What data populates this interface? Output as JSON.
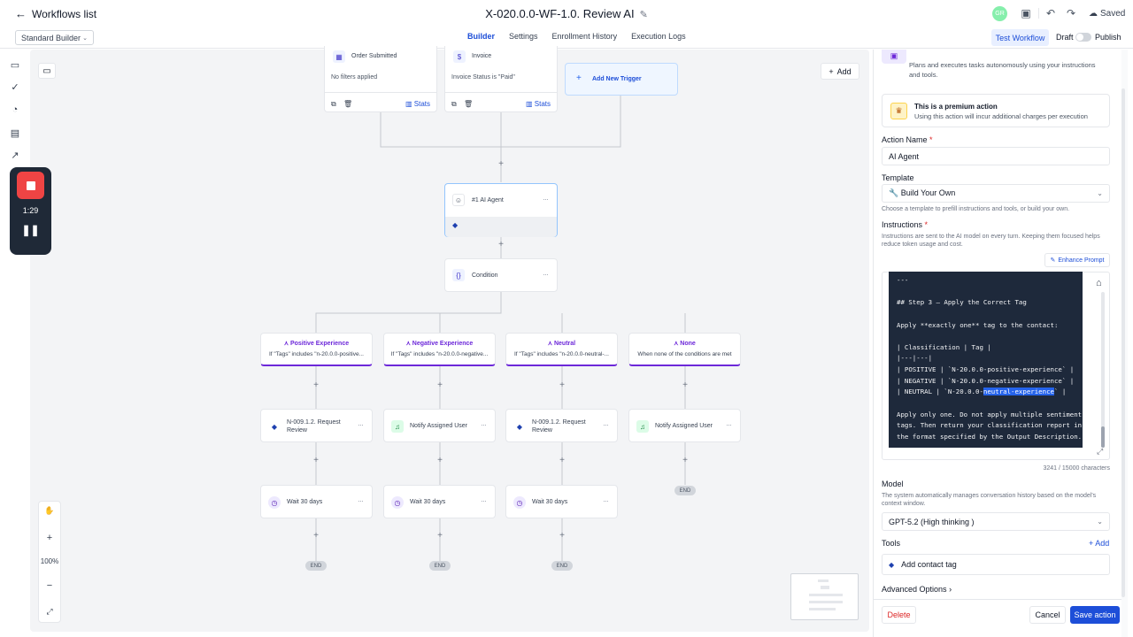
{
  "header": {
    "back_label": "Workflows list",
    "workflow_title": "X-020.0.0-WF-1.0. Review AI",
    "avatar_initials": "GR",
    "saved_label": "Saved"
  },
  "subbar": {
    "builder_mode": "Standard Builder",
    "tabs": [
      {
        "label": "Builder",
        "active": true
      },
      {
        "label": "Settings",
        "active": false
      },
      {
        "label": "Enrollment History",
        "active": false
      },
      {
        "label": "Execution Logs",
        "active": false
      }
    ],
    "test_button": "Test Workflow",
    "draft_label": "Draft",
    "publish_label": "Publish"
  },
  "recorder": {
    "time": "1:29"
  },
  "canvas": {
    "add_button": "Add",
    "zoom_level": "100%",
    "triggers": [
      {
        "title": "Order Submitted",
        "filter": "No filters applied",
        "stats": "Stats"
      },
      {
        "title": "Invoice",
        "filter": "Invoice Status is \"Paid\"",
        "stats": "Stats"
      }
    ],
    "add_trigger": "Add New Trigger",
    "ai_agent_node": "#1 AI Agent",
    "condition_node": "Condition",
    "branches": [
      {
        "title": "Positive Experience",
        "desc": "If \"Tags\" includes \"n-20.0.0-positive..."
      },
      {
        "title": "Negative Experience",
        "desc": "If \"Tags\" includes \"n-20.0.0-negative..."
      },
      {
        "title": "Neutral",
        "desc": "If \"Tags\" includes \"n-20.0.0-neutral-..."
      },
      {
        "title": "None",
        "desc": "When none of the conditions are met"
      }
    ],
    "step1": [
      {
        "title": "N-009.1.2. Request Review",
        "kind": "tag"
      },
      {
        "title": "Notify Assigned User",
        "kind": "notify"
      },
      {
        "title": "N-009.1.2. Request Review",
        "kind": "tag"
      },
      {
        "title": "Notify Assigned User",
        "kind": "notify"
      }
    ],
    "wait_label": "Wait 30 days",
    "end_label": "END"
  },
  "panel": {
    "agent_desc_line1": "Plans and executes tasks autonomously using your instructions",
    "agent_desc_line2": "and tools.",
    "premium_title": "This is a premium action",
    "premium_desc": "Using this action will incur additional charges per execution",
    "action_name_label": "Action Name",
    "action_name_value": "AI Agent",
    "template_label": "Template",
    "template_value": "Build Your Own",
    "template_help": "Choose a template to prefill instructions and tools, or build your own.",
    "instructions_label": "Instructions",
    "instructions_help_1": "Instructions are sent to the AI model on every turn. Keeping them focused helps",
    "instructions_help_2": "reduce token usage and cost.",
    "enhance_prompt": "Enhance Prompt",
    "code_lines": [
      "---",
      "",
      "## Step 3 — Apply the Correct Tag",
      "",
      "Apply **exactly one** tag to the contact:",
      "",
      "| Classification | Tag |",
      "|---|---|",
      "| POSITIVE | `N-20.0.0-positive-experience` |",
      "| NEGATIVE | `N-20.0.0-negative-experience` |",
      "| NEUTRAL | `N-20.0.0-",
      "",
      "Apply only one. Do not apply multiple sentiment",
      "tags. Then return your classification report in",
      "the format specified by the Output Description."
    ],
    "neutral_highlight": "neutral-experience",
    "neutral_tail": "` |",
    "char_count": "3241 / 15000 characters",
    "model_label": "Model",
    "model_help_1": "The system automatically manages conversation history based on the model's",
    "model_help_2": "context window.",
    "model_value": "GPT-5.2 (High thinking )",
    "tools_label": "Tools",
    "tools_add": "Add",
    "tool_item": "Add contact tag",
    "advanced_options": "Advanced Options",
    "delete_label": "Delete",
    "cancel_label": "Cancel",
    "save_label": "Save action"
  },
  "colors": {
    "accent": "#1d4ed8",
    "branch_purple": "#6d28d9",
    "danger": "#dc2626",
    "recorder_red": "#ef4444"
  }
}
